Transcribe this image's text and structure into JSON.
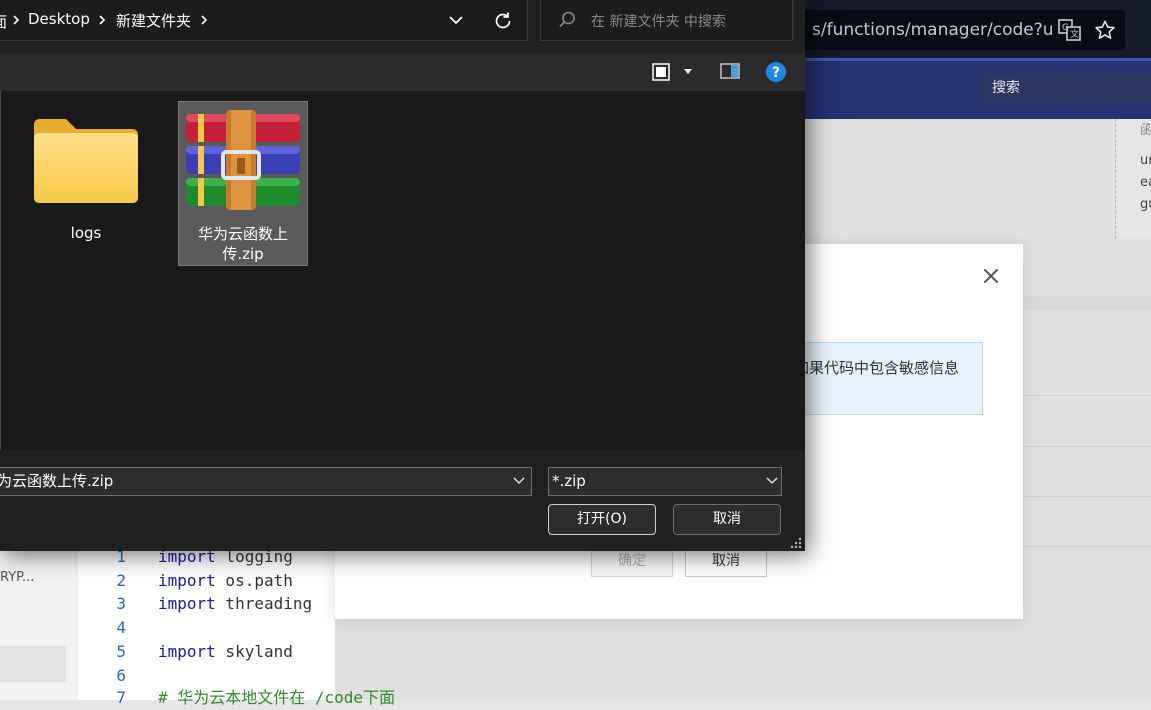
{
  "browser": {
    "address_text": "s/functions/manager/code?ur",
    "site_search_placeholder": "搜索",
    "right_panel_lines": [
      "函",
      "ur",
      "ea",
      "gu"
    ]
  },
  "modal": {
    "notice_text": "如果代码中包含敏感信息",
    "confirm_label": "确定",
    "cancel_label": "取消"
  },
  "editor": {
    "sidebar_item": "RYP...",
    "lines": [
      {
        "n": "1",
        "kw": "import",
        "rest": " logging"
      },
      {
        "n": "2",
        "kw": "import",
        "rest": " os.path"
      },
      {
        "n": "3",
        "kw": "import",
        "rest": " threading"
      },
      {
        "n": "4",
        "kw": "",
        "rest": ""
      },
      {
        "n": "5",
        "kw": "import",
        "rest": " skyland"
      },
      {
        "n": "6",
        "kw": "",
        "rest": ""
      },
      {
        "n": "7",
        "kw": "",
        "rest": "# 华为云本地文件在 /code下面"
      }
    ]
  },
  "dialog": {
    "breadcrumbs": [
      "面",
      "Desktop",
      "新建文件夹"
    ],
    "search_placeholder": "在 新建文件夹 中搜索",
    "items": [
      {
        "name": "logs",
        "type": "folder"
      },
      {
        "name": "华为云函数上传.zip",
        "type": "zip",
        "selected": true
      }
    ],
    "file_name_value": "为云函数上传.zip",
    "file_type_value": "*.zip",
    "open_label": "打开(O)",
    "cancel_label": "取消"
  }
}
